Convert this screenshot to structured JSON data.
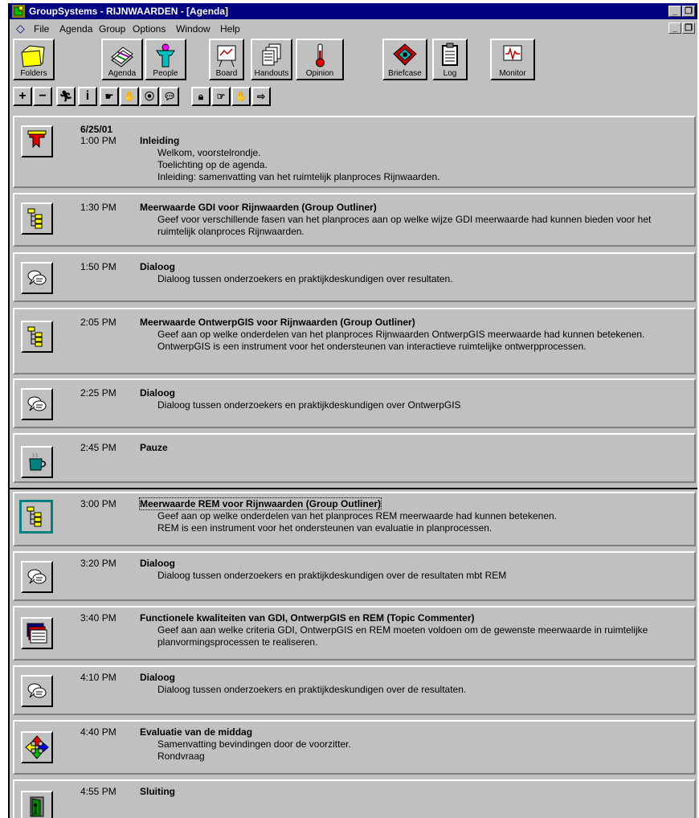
{
  "window": {
    "title": "GroupSystems - RIJNWAARDEN - [Agenda]"
  },
  "menu": [
    "File",
    "Agenda",
    "Group",
    "Options",
    "Window",
    "Help"
  ],
  "toolbar": {
    "buttons": [
      "Folders",
      "Agenda",
      "People",
      "Board",
      "Handouts",
      "Opinion",
      "Briefcase",
      "Log",
      "Monitor"
    ]
  },
  "agenda": {
    "date": "6/25/01",
    "items": [
      {
        "time": "1:00 PM",
        "title": "Inleiding",
        "icon": "megaphone-icon",
        "lines": [
          "Welkom, voorstelrondje.",
          "Toelichting op de agenda.",
          "Inleiding: samenvatting van het ruimtelijk planproces Rijnwaarden."
        ]
      },
      {
        "time": "1:30 PM",
        "title": "Meerwaarde GDI voor Rijnwaarden (Group Outliner)",
        "icon": "outliner-icon",
        "lines": [
          "Geef voor verschillende fasen van het planproces aan op welke wijze GDI meerwaarde had kunnen bieden voor het ruimtelijk olanproces Rijnwaarden."
        ]
      },
      {
        "time": "1:50 PM",
        "title": "Dialoog",
        "icon": "dialog-icon",
        "lines": [
          "Dialoog tussen onderzoekers en praktijkdeskundigen over resultaten."
        ]
      },
      {
        "time": "2:05 PM",
        "title": "Meerwaarde OntwerpGIS voor Rijnwaarden (Group Outliner)",
        "icon": "outliner-icon",
        "lines": [
          "Geef aan op welke onderdelen van het planproces Rijnwaarden OntwerpGIS meerwaarde had kunnen betekenen.",
          "OntwerpGIS is een instrument voor het ondersteunen van interactieve ruimtelijke ontwerpprocessen."
        ]
      },
      {
        "time": "2:25 PM",
        "title": "Dialoog",
        "icon": "dialog-icon",
        "lines": [
          "Dialoog tussen onderzoekers en praktijkdeskundigen over OntwerpGIS"
        ]
      },
      {
        "time": "2:45 PM",
        "title": "Pauze",
        "icon": "coffee-cup-icon",
        "lines": []
      },
      {
        "time": "3:00 PM",
        "title": "Meerwaarde REM voor Rijnwaarden (Group Outliner)",
        "icon": "outliner-icon",
        "lines": [
          "Geef aan op welke onderdelen van het planproces REM meerwaarde had kunnen betekenen.",
          "REM is een instrument voor het ondersteunen van evaluatie in planprocessen."
        ]
      },
      {
        "time": "3:20 PM",
        "title": "Dialoog",
        "icon": "dialog-icon",
        "lines": [
          "Dialoog tussen onderzoekers en praktijkdeskundigen over de resultaten mbt REM"
        ]
      },
      {
        "time": "3:40 PM",
        "title": "Functionele kwaliteiten van GDI, OntwerpGIS en REM (Topic Commenter)",
        "icon": "topic-commenter-icon",
        "lines": [
          "Geef aan aan welke criteria GDI, OntwerpGIS en REM moeten voldoen om de gewenste meerwaarde in ruimtelijke planvormingsprocessen te realiseren."
        ]
      },
      {
        "time": "4:10 PM",
        "title": "Dialoog",
        "icon": "dialog-icon",
        "lines": [
          "Dialoog tussen onderzoekers en praktijkdeskundigen over de resultaten."
        ]
      },
      {
        "time": "4:40 PM",
        "title": "Evaluatie van de middag",
        "icon": "four-arrows-icon",
        "lines": [
          "Samenvatting bevindingen door de voorzitter.",
          "Rondvraag"
        ]
      },
      {
        "time": "4:55 PM",
        "title": "Sluiting",
        "icon": "exit-door-icon",
        "lines": []
      }
    ]
  }
}
